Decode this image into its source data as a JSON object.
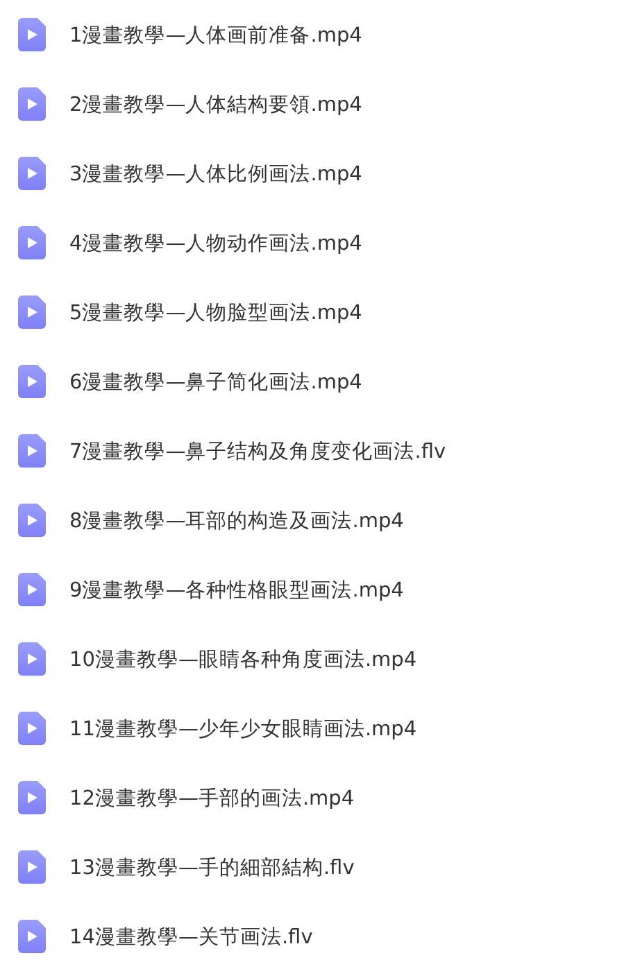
{
  "files": [
    {
      "name": "1漫畫教學—人体画前准备.mp4"
    },
    {
      "name": "2漫畫教學—人体結构要領.mp4"
    },
    {
      "name": "3漫畫教學—人体比例画法.mp4"
    },
    {
      "name": "4漫畫教學—人物动作画法.mp4"
    },
    {
      "name": "5漫畫教學—人物脸型画法.mp4"
    },
    {
      "name": "6漫畫教學—鼻子简化画法.mp4"
    },
    {
      "name": "7漫畫教學—鼻子结构及角度变化画法.flv"
    },
    {
      "name": "8漫畫教學—耳部的构造及画法.mp4"
    },
    {
      "name": "9漫畫教學—各种性格眼型画法.mp4"
    },
    {
      "name": "10漫畫教學—眼睛各种角度画法.mp4"
    },
    {
      "name": "11漫畫教學—少年少女眼睛画法.mp4"
    },
    {
      "name": "12漫畫教學—手部的画法.mp4"
    },
    {
      "name": "13漫畫教學—手的細部結构.flv"
    },
    {
      "name": "14漫畫教學—关节画法.flv"
    }
  ]
}
